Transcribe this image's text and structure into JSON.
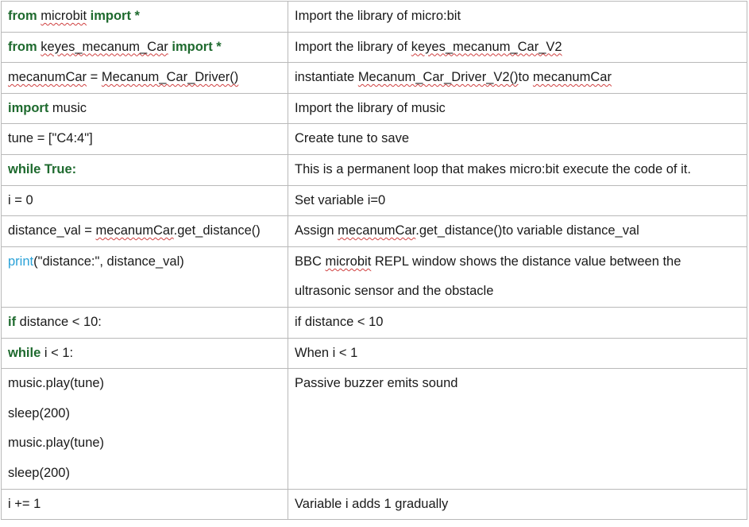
{
  "rows": [
    {
      "code": [
        [
          {
            "t": "from",
            "k": true
          },
          {
            "t": " "
          },
          {
            "t": "microbit",
            "sq": true
          },
          {
            "t": " "
          },
          {
            "t": "import *",
            "k": true
          }
        ]
      ],
      "desc": [
        [
          {
            "t": "Import the library of micro:bit"
          }
        ]
      ]
    },
    {
      "code": [
        [
          {
            "t": "from",
            "k": true
          },
          {
            "t": " "
          },
          {
            "t": "keyes_mecanum_Car",
            "sq": true
          },
          {
            "t": " "
          },
          {
            "t": "import *",
            "k": true
          }
        ]
      ],
      "desc": [
        [
          {
            "t": "Import the library of "
          },
          {
            "t": "keyes_mecanum_Car_V2",
            "sq": true
          }
        ]
      ]
    },
    {
      "code": [
        [
          {
            "t": "mecanumCar",
            "sq": true
          },
          {
            "t": " = "
          },
          {
            "t": "Mecanum_Car_Driver()",
            "sq": true
          }
        ]
      ],
      "desc": [
        [
          {
            "t": "instantiate "
          },
          {
            "t": "Mecanum_Car_Driver_V2()",
            "sq": true
          },
          {
            "t": "to "
          },
          {
            "t": "mecanumCar",
            "sq": true
          }
        ]
      ]
    },
    {
      "code": [
        [
          {
            "t": "import",
            "k": true
          },
          {
            "t": " music"
          }
        ]
      ],
      "desc": [
        [
          {
            "t": "Import the library of music"
          }
        ]
      ]
    },
    {
      "code": [
        [
          {
            "t": "tune = [\"C4:4\"]"
          }
        ]
      ],
      "desc": [
        [
          {
            "t": "Create tune to save"
          }
        ]
      ]
    },
    {
      "code": [
        [
          {
            "t": "while True:",
            "k": true
          }
        ]
      ],
      "desc": [
        [
          {
            "t": "This is a permanent loop that makes micro:bit execute the code of it."
          }
        ]
      ]
    },
    {
      "code": [
        [
          {
            "t": "i = 0"
          }
        ]
      ],
      "desc": [
        [
          {
            "t": "Set variable i=0"
          }
        ]
      ]
    },
    {
      "code": [
        [
          {
            "t": "distance_val = "
          },
          {
            "t": "mecanumCar",
            "sq": true
          },
          {
            "t": ".get_distance()"
          }
        ]
      ],
      "desc": [
        [
          {
            "t": "Assign "
          },
          {
            "t": "mecanumCar",
            "sq": true
          },
          {
            "t": ".get_distance()to variable distance_val"
          }
        ]
      ]
    },
    {
      "code": [
        [
          {
            "t": "print",
            "f": true
          },
          {
            "t": "(\"distance:\", distance_val)"
          }
        ]
      ],
      "desc": [
        [
          {
            "t": "BBC "
          },
          {
            "t": "microbit",
            "sq": true
          },
          {
            "t": " REPL window shows the distance value between the"
          }
        ],
        [
          {
            "t": "ultrasonic sensor and the obstacle"
          }
        ]
      ]
    },
    {
      "code": [
        [
          {
            "t": "if",
            "k": true
          },
          {
            "t": " distance < 10:"
          }
        ]
      ],
      "desc": [
        [
          {
            "t": "if distance < 10"
          }
        ]
      ]
    },
    {
      "code": [
        [
          {
            "t": "while",
            "k": true
          },
          {
            "t": " i < 1:"
          }
        ]
      ],
      "desc": [
        [
          {
            "t": "When i < 1"
          }
        ]
      ]
    },
    {
      "code": [
        [
          {
            "t": "music.play(tune)"
          }
        ],
        [
          {
            "t": "sleep(200)"
          }
        ],
        [
          {
            "t": "music.play(tune)"
          }
        ],
        [
          {
            "t": "sleep(200)"
          }
        ]
      ],
      "desc": [
        [
          {
            "t": "Passive buzzer emits sound"
          }
        ]
      ]
    },
    {
      "code": [
        [
          {
            "t": "i += 1"
          }
        ]
      ],
      "desc": [
        [
          {
            "t": "Variable i adds 1 gradually"
          }
        ]
      ]
    }
  ]
}
